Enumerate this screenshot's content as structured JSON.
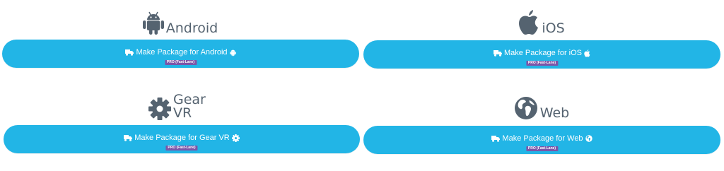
{
  "colors": {
    "button": "#22b5e6",
    "badge": "#7b55a8",
    "heading": "#556370"
  },
  "platforms": [
    {
      "name": "Android",
      "icon": "android-icon",
      "button_label": "Make Package for Android",
      "badge": "PRO (Fast-Lane)"
    },
    {
      "name": "iOS",
      "icon": "apple-icon",
      "button_label": "Make Package for iOS",
      "badge": "PRO (Fast-Lane)"
    },
    {
      "name": "Gear VR",
      "icon": "gear-icon",
      "button_label": "Make Package for Gear VR",
      "badge": "PRO (Fast-Lane)"
    },
    {
      "name": "Web",
      "icon": "globe-icon",
      "button_label": "Make Package for Web",
      "badge": "PRO (Fast-Lane)"
    }
  ]
}
